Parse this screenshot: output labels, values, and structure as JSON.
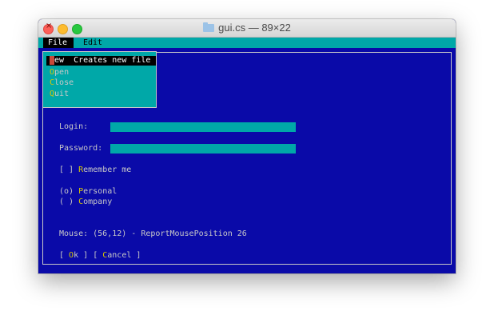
{
  "window": {
    "title": "gui.cs — 89×22"
  },
  "menubar": {
    "items": [
      {
        "label": "File"
      },
      {
        "label": "Edit"
      }
    ]
  },
  "file_menu": {
    "items": [
      {
        "hotkey": "N",
        "rest": "ew",
        "help": "Creates new file"
      },
      {
        "hotkey": "O",
        "rest": "pen"
      },
      {
        "hotkey": "C",
        "rest": "lose"
      },
      {
        "hotkey": "Q",
        "rest": "uit"
      }
    ]
  },
  "form": {
    "login_label": "Login:",
    "login_value": "",
    "password_label": "Password:",
    "password_value": "",
    "remember": {
      "box": "[ ] ",
      "hotkey": "R",
      "rest": "emember me"
    },
    "radios": [
      {
        "mark": "(o) ",
        "hotkey": "P",
        "rest": "ersonal"
      },
      {
        "mark": "( ) ",
        "hotkey": "C",
        "rest": "ompany"
      }
    ],
    "mouse_status": "Mouse: (56,12) - ReportMousePosition 26",
    "ok": {
      "open": "[ ",
      "hotkey": "O",
      "rest": "k",
      "close": " ]"
    },
    "cancel": {
      "open": "[ ",
      "hotkey": "C",
      "rest": "ancel",
      "close": " ]"
    }
  },
  "colors": {
    "background": "#0a0aa8",
    "accent": "#00a8a8",
    "hotkey": "#d8c800",
    "text": "#c8c8c8"
  }
}
